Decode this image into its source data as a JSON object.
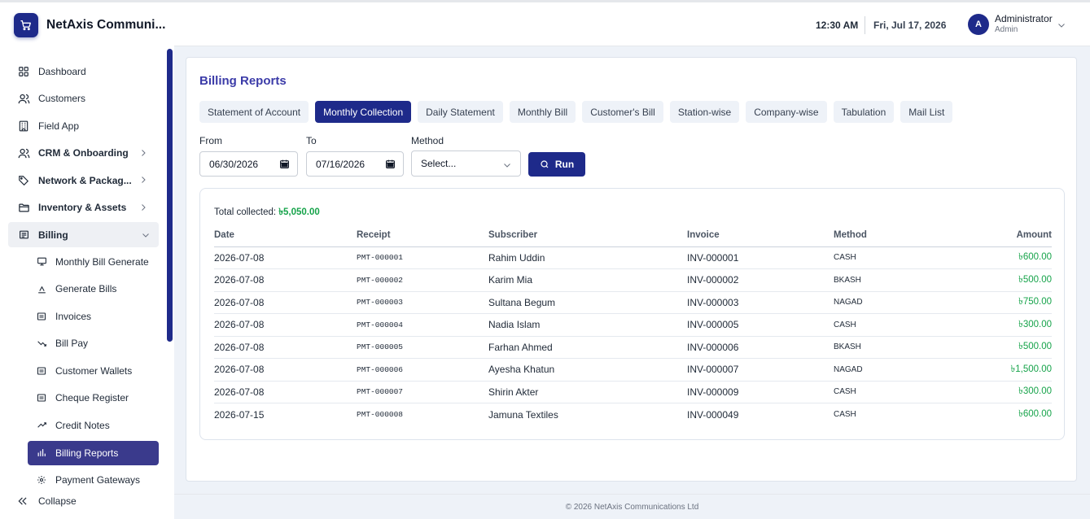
{
  "brand": {
    "name": "NetAxis Communi..."
  },
  "sidebar": {
    "items": [
      {
        "label": "Dashboard"
      },
      {
        "label": "Customers"
      },
      {
        "label": "Field App"
      },
      {
        "label": "CRM & Onboarding"
      },
      {
        "label": "Network & Packag..."
      },
      {
        "label": "Inventory & Assets"
      },
      {
        "label": "Billing"
      }
    ],
    "billing_sub": [
      {
        "label": "Monthly Bill Generate"
      },
      {
        "label": "Generate Bills"
      },
      {
        "label": "Invoices"
      },
      {
        "label": "Bill Pay"
      },
      {
        "label": "Customer Wallets"
      },
      {
        "label": "Cheque Register"
      },
      {
        "label": "Credit Notes"
      },
      {
        "label": "Billing Reports"
      },
      {
        "label": "Payment Gateways"
      }
    ],
    "collapse_label": "Collapse"
  },
  "header": {
    "time": "12:30 AM",
    "date": "Fri, Jul 17, 2026",
    "avatar_letter": "A",
    "user_name": "Administrator",
    "user_role": "Admin"
  },
  "page": {
    "title": "Billing Reports",
    "tabs": [
      {
        "label": "Statement of Account"
      },
      {
        "label": "Monthly Collection"
      },
      {
        "label": "Daily Statement"
      },
      {
        "label": "Monthly Bill"
      },
      {
        "label": "Customer's Bill"
      },
      {
        "label": "Station-wise"
      },
      {
        "label": "Company-wise"
      },
      {
        "label": "Tabulation"
      },
      {
        "label": "Mail List"
      }
    ],
    "active_tab": "Monthly Collection"
  },
  "filters": {
    "from_label": "From",
    "from_value": "06/30/2026",
    "to_label": "To",
    "to_value": "07/16/2026",
    "method_label": "Method",
    "method_placeholder": "Select...",
    "run_label": "Run"
  },
  "report": {
    "total_label": "Total collected:",
    "total_value": "৳5,050.00",
    "columns": [
      "Date",
      "Receipt",
      "Subscriber",
      "Invoice",
      "Method",
      "Amount"
    ],
    "rows": [
      {
        "date": "2026-07-08",
        "receipt": "PMT-000001",
        "subscriber": "Rahim Uddin",
        "invoice": "INV-000001",
        "method": "CASH",
        "amount": "৳600.00"
      },
      {
        "date": "2026-07-08",
        "receipt": "PMT-000002",
        "subscriber": "Karim Mia",
        "invoice": "INV-000002",
        "method": "BKASH",
        "amount": "৳500.00"
      },
      {
        "date": "2026-07-08",
        "receipt": "PMT-000003",
        "subscriber": "Sultana Begum",
        "invoice": "INV-000003",
        "method": "NAGAD",
        "amount": "৳750.00"
      },
      {
        "date": "2026-07-08",
        "receipt": "PMT-000004",
        "subscriber": "Nadia Islam",
        "invoice": "INV-000005",
        "method": "CASH",
        "amount": "৳300.00"
      },
      {
        "date": "2026-07-08",
        "receipt": "PMT-000005",
        "subscriber": "Farhan Ahmed",
        "invoice": "INV-000006",
        "method": "BKASH",
        "amount": "৳500.00"
      },
      {
        "date": "2026-07-08",
        "receipt": "PMT-000006",
        "subscriber": "Ayesha Khatun",
        "invoice": "INV-000007",
        "method": "NAGAD",
        "amount": "৳1,500.00"
      },
      {
        "date": "2026-07-08",
        "receipt": "PMT-000007",
        "subscriber": "Shirin Akter",
        "invoice": "INV-000009",
        "method": "CASH",
        "amount": "৳300.00"
      },
      {
        "date": "2026-07-15",
        "receipt": "PMT-000008",
        "subscriber": "Jamuna Textiles",
        "invoice": "INV-000049",
        "method": "CASH",
        "amount": "৳600.00"
      }
    ]
  },
  "footer": {
    "text": "© 2026 NetAxis Communications Ltd"
  },
  "colors": {
    "primary": "#1e2a8a",
    "active_sub": "#3a3a8c",
    "title": "#3b3ba8",
    "amount": "#16a34a"
  }
}
